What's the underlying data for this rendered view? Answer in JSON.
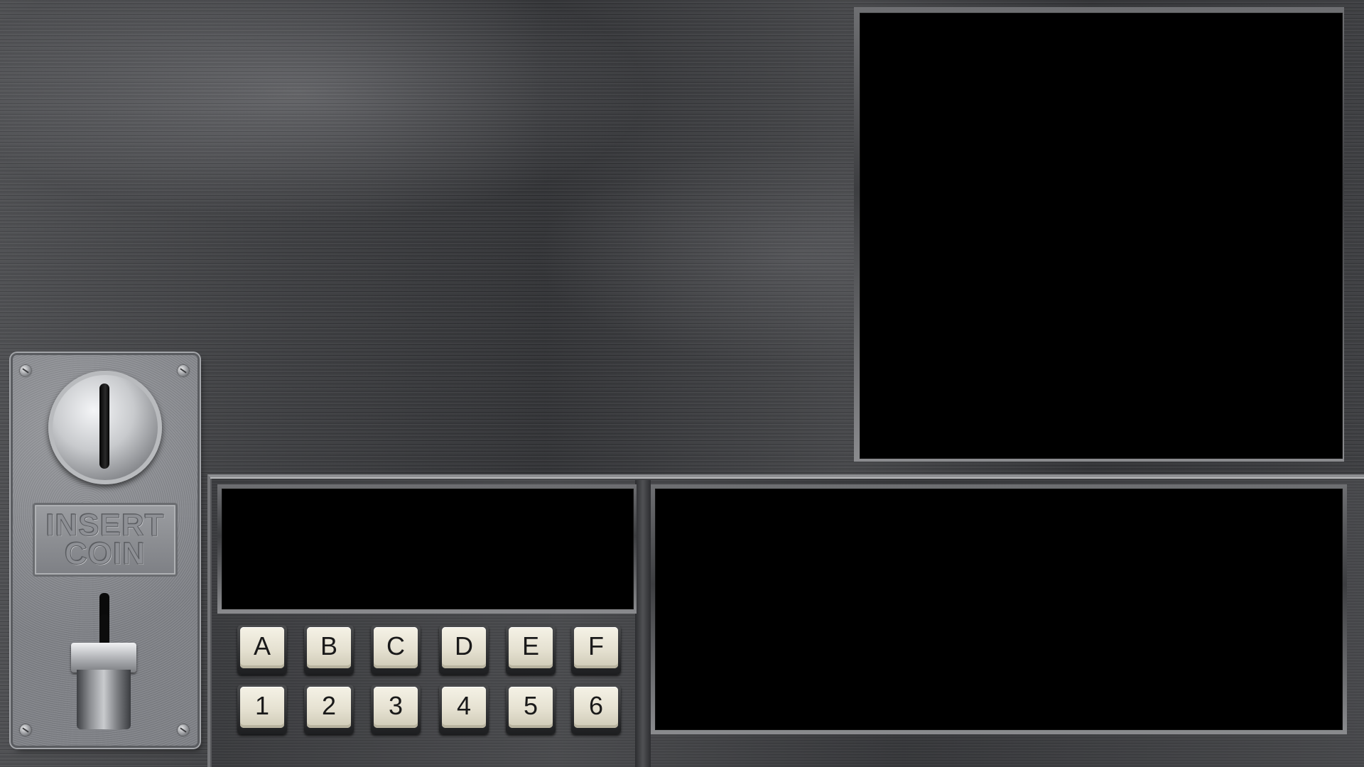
{
  "coin_door": {
    "label_line1": "INSERT",
    "label_line2": "COIN"
  },
  "keypad": {
    "letter_keys": [
      "A",
      "B",
      "C",
      "D",
      "E",
      "F"
    ],
    "number_keys": [
      "1",
      "2",
      "3",
      "4",
      "5",
      "6"
    ]
  },
  "colors": {
    "key_cap": "#e9e5d6",
    "screen": "#000000",
    "panel_metal": "#3c3d40"
  }
}
